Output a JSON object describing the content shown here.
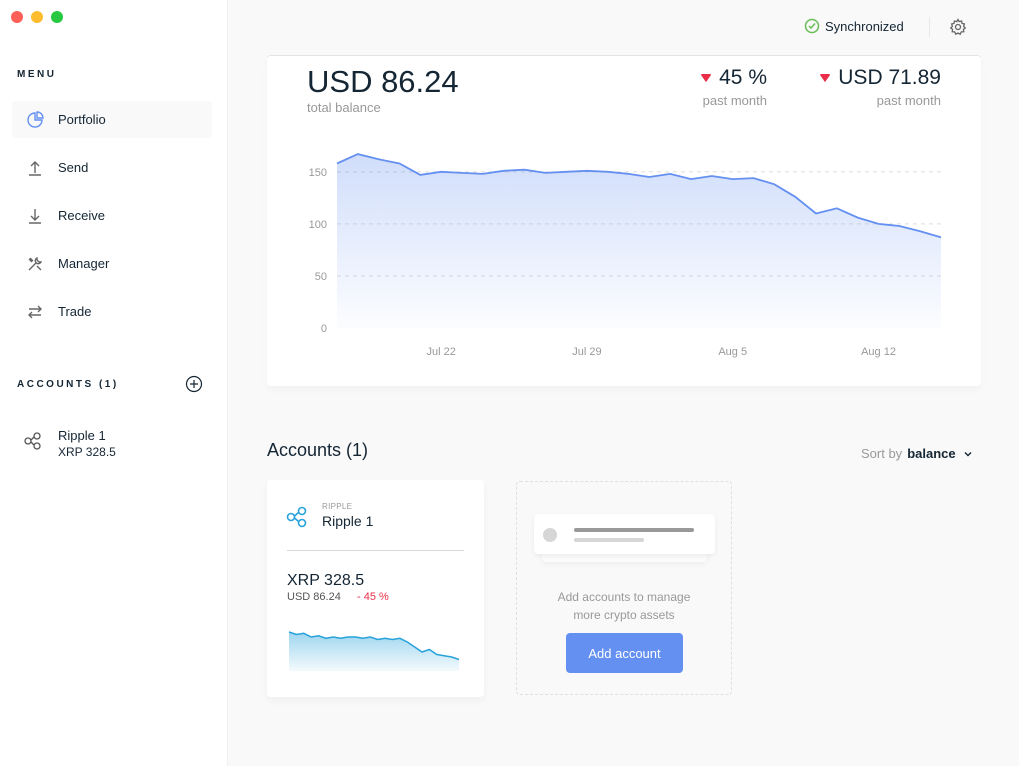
{
  "window": {
    "controls": [
      "close",
      "minimize",
      "maximize"
    ]
  },
  "sidebar": {
    "menu_title": "MENU",
    "items": [
      {
        "label": "Portfolio",
        "icon": "pie-chart-icon",
        "active": true
      },
      {
        "label": "Send",
        "icon": "upload-arrow-icon"
      },
      {
        "label": "Receive",
        "icon": "download-arrow-icon"
      },
      {
        "label": "Manager",
        "icon": "tools-icon"
      },
      {
        "label": "Trade",
        "icon": "swap-arrows-icon"
      }
    ],
    "accounts_title": "ACCOUNTS (1)",
    "accounts": [
      {
        "name": "Ripple 1",
        "balance": "XRP 328.5",
        "icon": "ripple-icon"
      }
    ]
  },
  "topbar": {
    "sync_status": "Synchronized",
    "sync_icon": "check-circle-icon",
    "settings_icon": "gear-icon"
  },
  "balance": {
    "total": "USD 86.24",
    "total_label": "total balance",
    "change_pct": "45 %",
    "change_pct_label": "past month",
    "change_value": "USD 71.89",
    "change_value_label": "past month"
  },
  "colors": {
    "accent": "#6490f1",
    "negative": "#ea2e49",
    "positive": "#66be54",
    "ripple": "#27a2db"
  },
  "chart_data": {
    "type": "area",
    "y_ticks": [
      0,
      50,
      100,
      150
    ],
    "x_ticks": [
      "Jul 22",
      "Jul 29",
      "Aug 5",
      "Aug 12"
    ],
    "x_tick_index": [
      5,
      12,
      19,
      26
    ],
    "ylim": [
      0,
      170
    ],
    "grid": true,
    "series": [
      {
        "values": [
          158,
          167,
          162,
          158,
          147,
          150,
          149,
          148,
          151,
          152,
          149,
          150,
          151,
          150,
          148,
          145,
          148,
          143,
          146,
          143,
          144,
          138,
          126,
          110,
          115,
          106,
          100,
          98,
          93,
          87
        ]
      }
    ]
  },
  "accounts_section": {
    "title": "Accounts (1)",
    "sort_label": "Sort by",
    "sort_value": "balance",
    "cards": [
      {
        "currency": "RIPPLE",
        "name": "Ripple 1",
        "amount": "XRP 328.5",
        "fiat": "USD 86.24",
        "change": "- 45 %",
        "mini_chart": [
          88,
          86,
          87,
          84,
          85,
          83,
          84,
          83,
          84,
          84,
          83,
          84,
          82,
          83,
          82,
          83,
          80,
          76,
          72,
          74,
          70,
          69,
          68,
          66
        ]
      }
    ],
    "placeholder_text_1": "Add accounts to manage",
    "placeholder_text_2": "more crypto assets",
    "add_button": "Add account"
  }
}
